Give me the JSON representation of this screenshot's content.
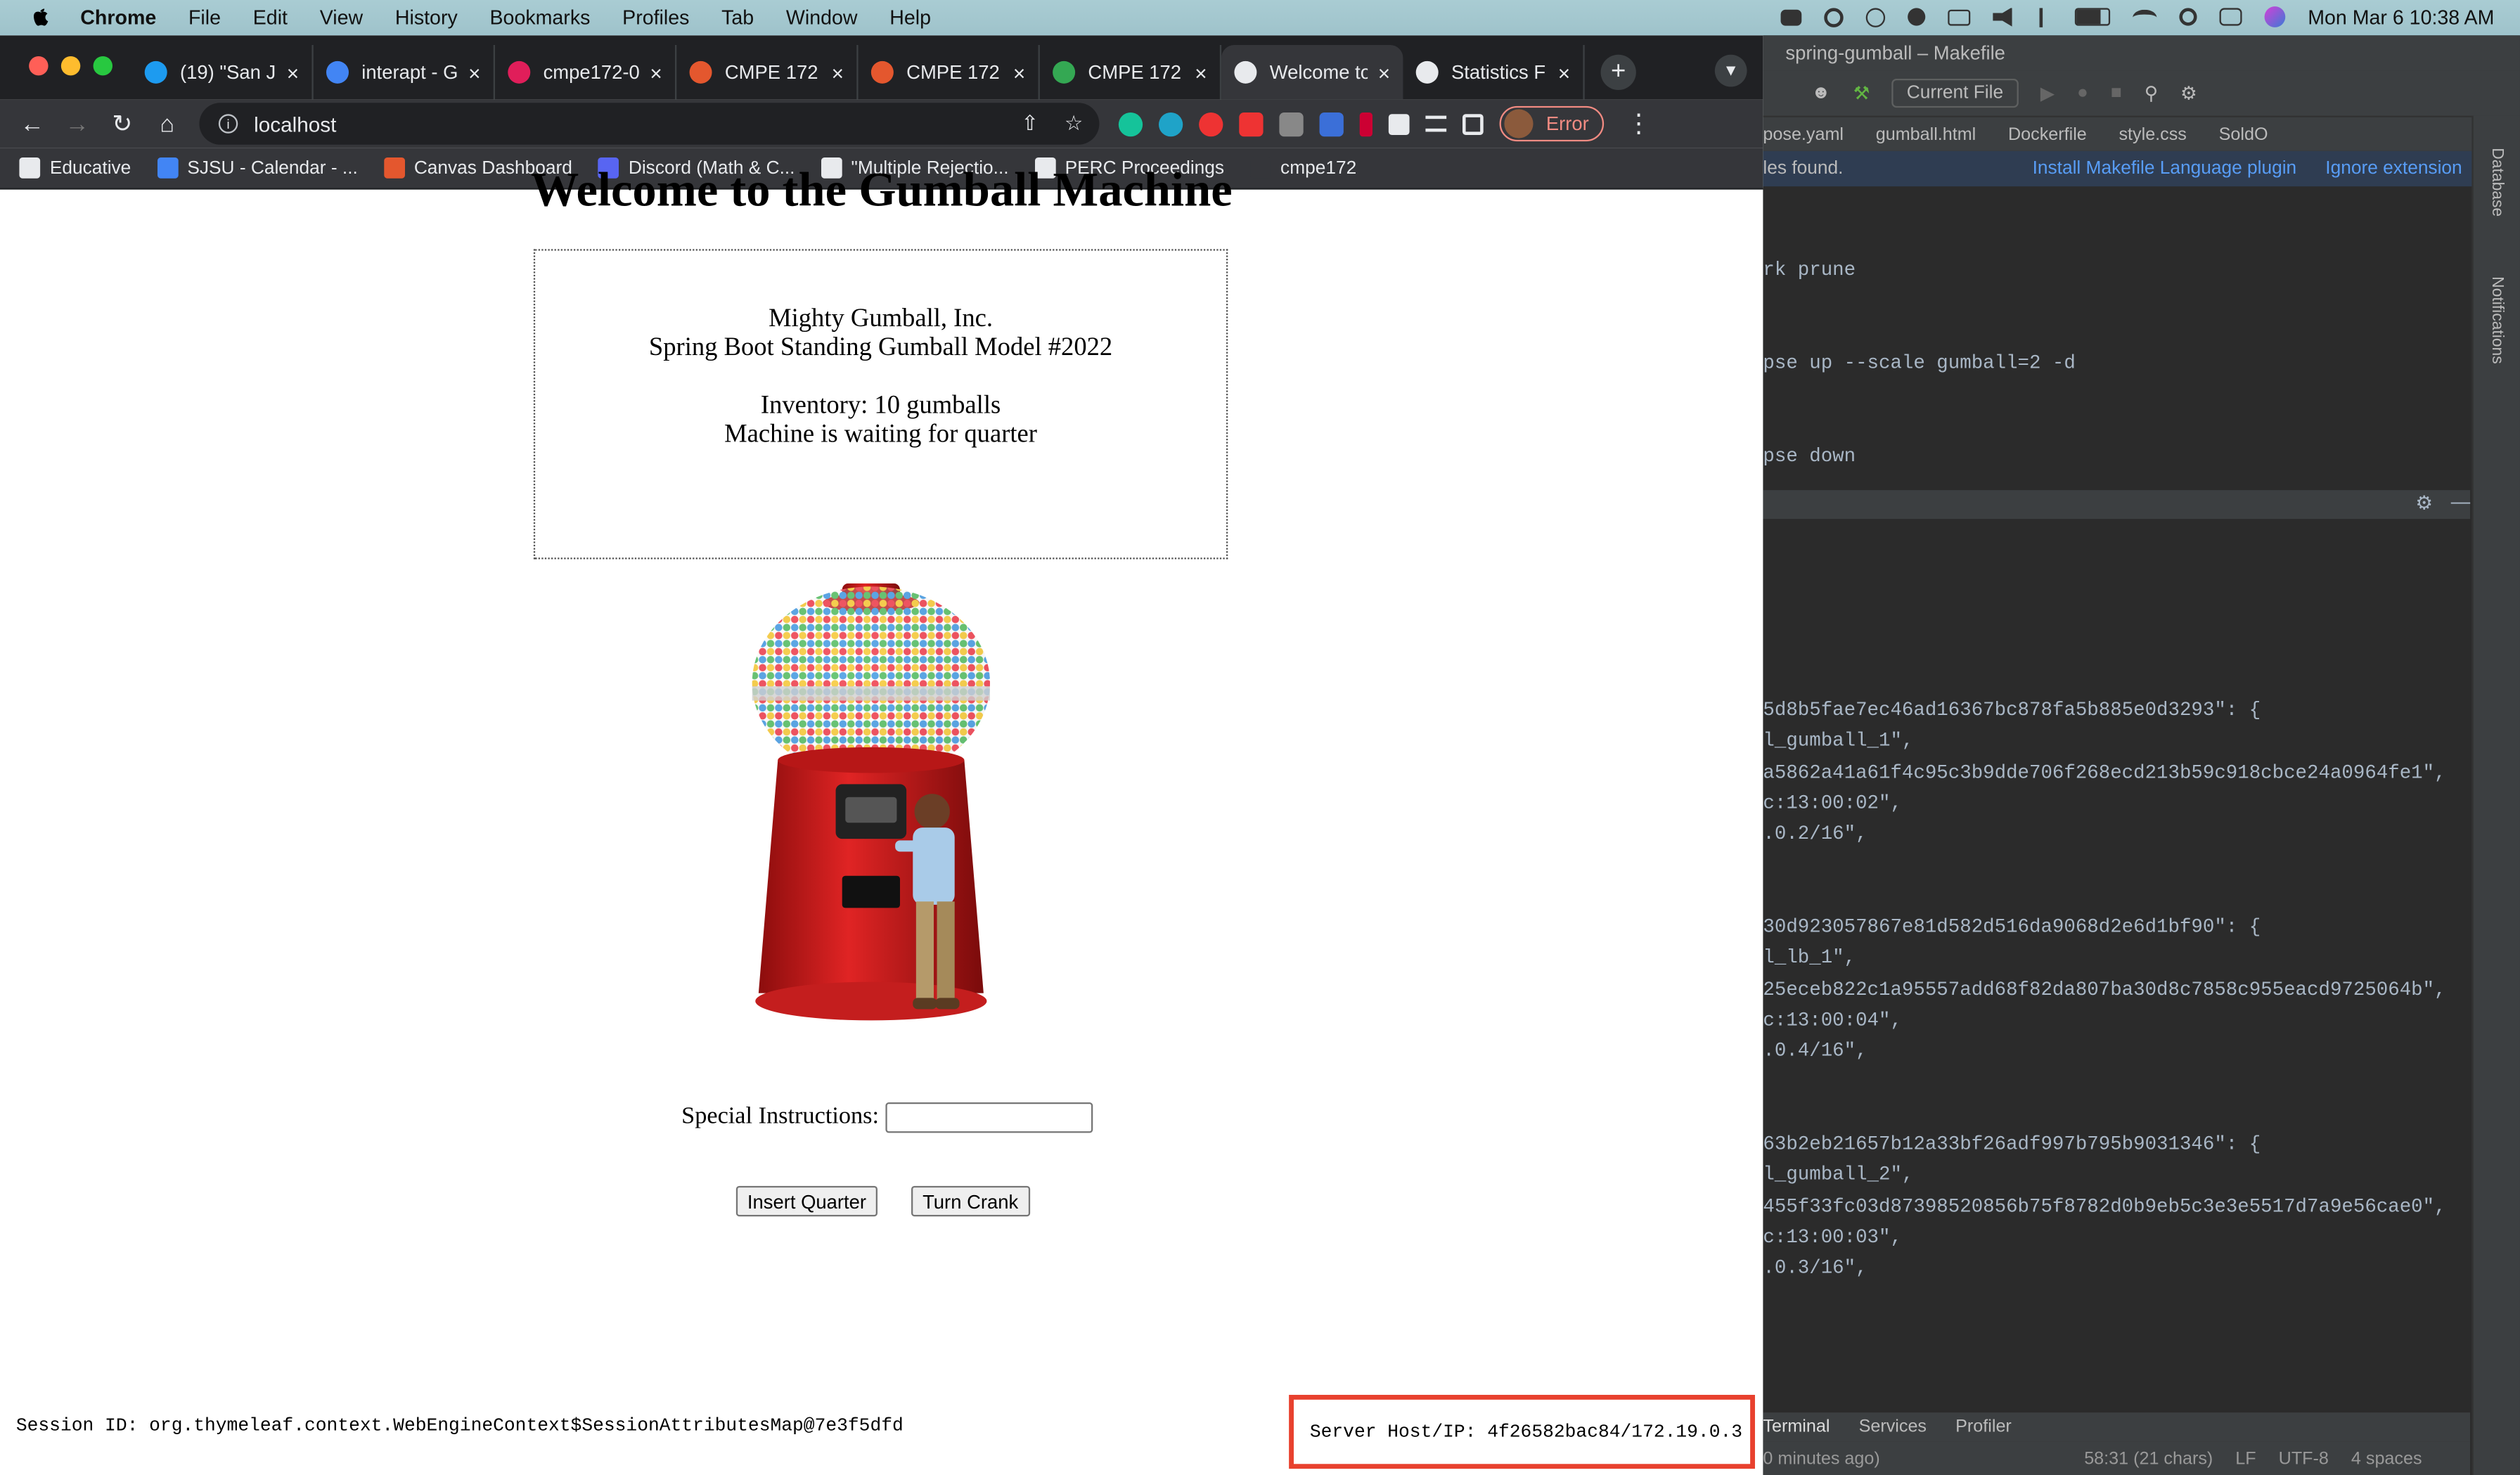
{
  "menubar": {
    "app": "Chrome",
    "menus": [
      "File",
      "Edit",
      "View",
      "History",
      "Bookmarks",
      "Profiles",
      "Tab",
      "Window",
      "Help"
    ],
    "datetime": "Mon Mar 6  10:38 AM"
  },
  "browser": {
    "tabs": [
      {
        "title": "(19) \"San J",
        "favicon_color": "#1d9bf0"
      },
      {
        "title": "interapt - G",
        "favicon_color": "#4285f4"
      },
      {
        "title": "cmpe172-0",
        "favicon_color": "#e01e5a"
      },
      {
        "title": "CMPE 172",
        "favicon_color": "#e4572e"
      },
      {
        "title": "CMPE 172",
        "favicon_color": "#e4572e"
      },
      {
        "title": "CMPE 172 (",
        "favicon_color": "#34a853"
      },
      {
        "title": "Welcome to",
        "favicon_color": "#e8eaed",
        "active": true
      },
      {
        "title": "Statistics F",
        "favicon_color": "#e8eaed"
      }
    ],
    "url": "localhost",
    "profile_status": "Error",
    "bookmarks": [
      {
        "label": "Educative",
        "color": "#e8eaed"
      },
      {
        "label": "SJSU - Calendar - ...",
        "color": "#4285f4"
      },
      {
        "label": "Canvas Dashboard",
        "color": "#e4572e"
      },
      {
        "label": "Discord (Math & C...",
        "color": "#5865f2"
      },
      {
        "label": "\"Multiple Rejectio...",
        "color": "#e8eaed"
      },
      {
        "label": "PERC Proceedings",
        "color": "#e8eaed"
      },
      {
        "label": "cmpe172",
        "color": "#35363a"
      }
    ]
  },
  "page": {
    "title": "Welcome to the Gumball Machine",
    "company": "Mighty Gumball, Inc.",
    "model": "Spring Boot Standing Gumball Model #2022",
    "inventory": "Inventory: 10 gumballs",
    "state": "Machine is waiting for quarter",
    "special_label": "Special Instructions:",
    "special_value": "",
    "insert_button": "Insert Quarter",
    "crank_button": "Turn Crank",
    "session": "Session ID:  org.thymeleaf.context.WebEngineContext$SessionAttributesMap@7e3f5dfd",
    "server": "Server Host/IP:  4f26582bac84/172.19.0.3"
  },
  "ide": {
    "title": "spring-gumball – Makefile",
    "current_file": "Current File",
    "file_tabs": [
      "pose.yaml",
      "gumball.html",
      "Dockerfile",
      "style.css",
      "SoldO"
    ],
    "notice": "les found.",
    "notice_link1": "Install Makefile Language plugin",
    "notice_link2": "Ignore extension",
    "code_lines": [
      "rk prune",
      "pse up --scale gumball=2 -d",
      "pse down"
    ],
    "terminal_lines": [
      "5d8b5fae7ec46ad16367bc878fa5b885e0d3293\": {",
      "l_gumball_1\",",
      "a5862a41a61f4c95c3b9dde706f268ecd213b59c918cbce24a0964fe1\",",
      "c:13:00:02\",",
      ".0.2/16\",",
      "30d923057867e81d582d516da9068d2e6d1bf90\": {",
      "l_lb_1\",",
      "25eceb822c1a95557add68f82da807ba30d8c7858c955eacd9725064b\",",
      "c:13:00:04\",",
      ".0.4/16\",",
      "63b2eb21657b12a33bf26adf997b795b9031346\": {",
      "l_gumball_2\",",
      "455f33fc03d87398520856b75f8782d0b9eb5c3e3e5517d7a9e56cae0\",",
      "c:13:00:03\",",
      ".0.3/16\","
    ],
    "tool_tabs": [
      "Terminal",
      "Services",
      "Profiler"
    ],
    "status": [
      "58:31 (21 chars)",
      "LF",
      "UTF-8",
      "4 spaces"
    ],
    "footer": "0 minutes ago)",
    "rail_database": "Database",
    "rail_notifications": "Notifications"
  }
}
